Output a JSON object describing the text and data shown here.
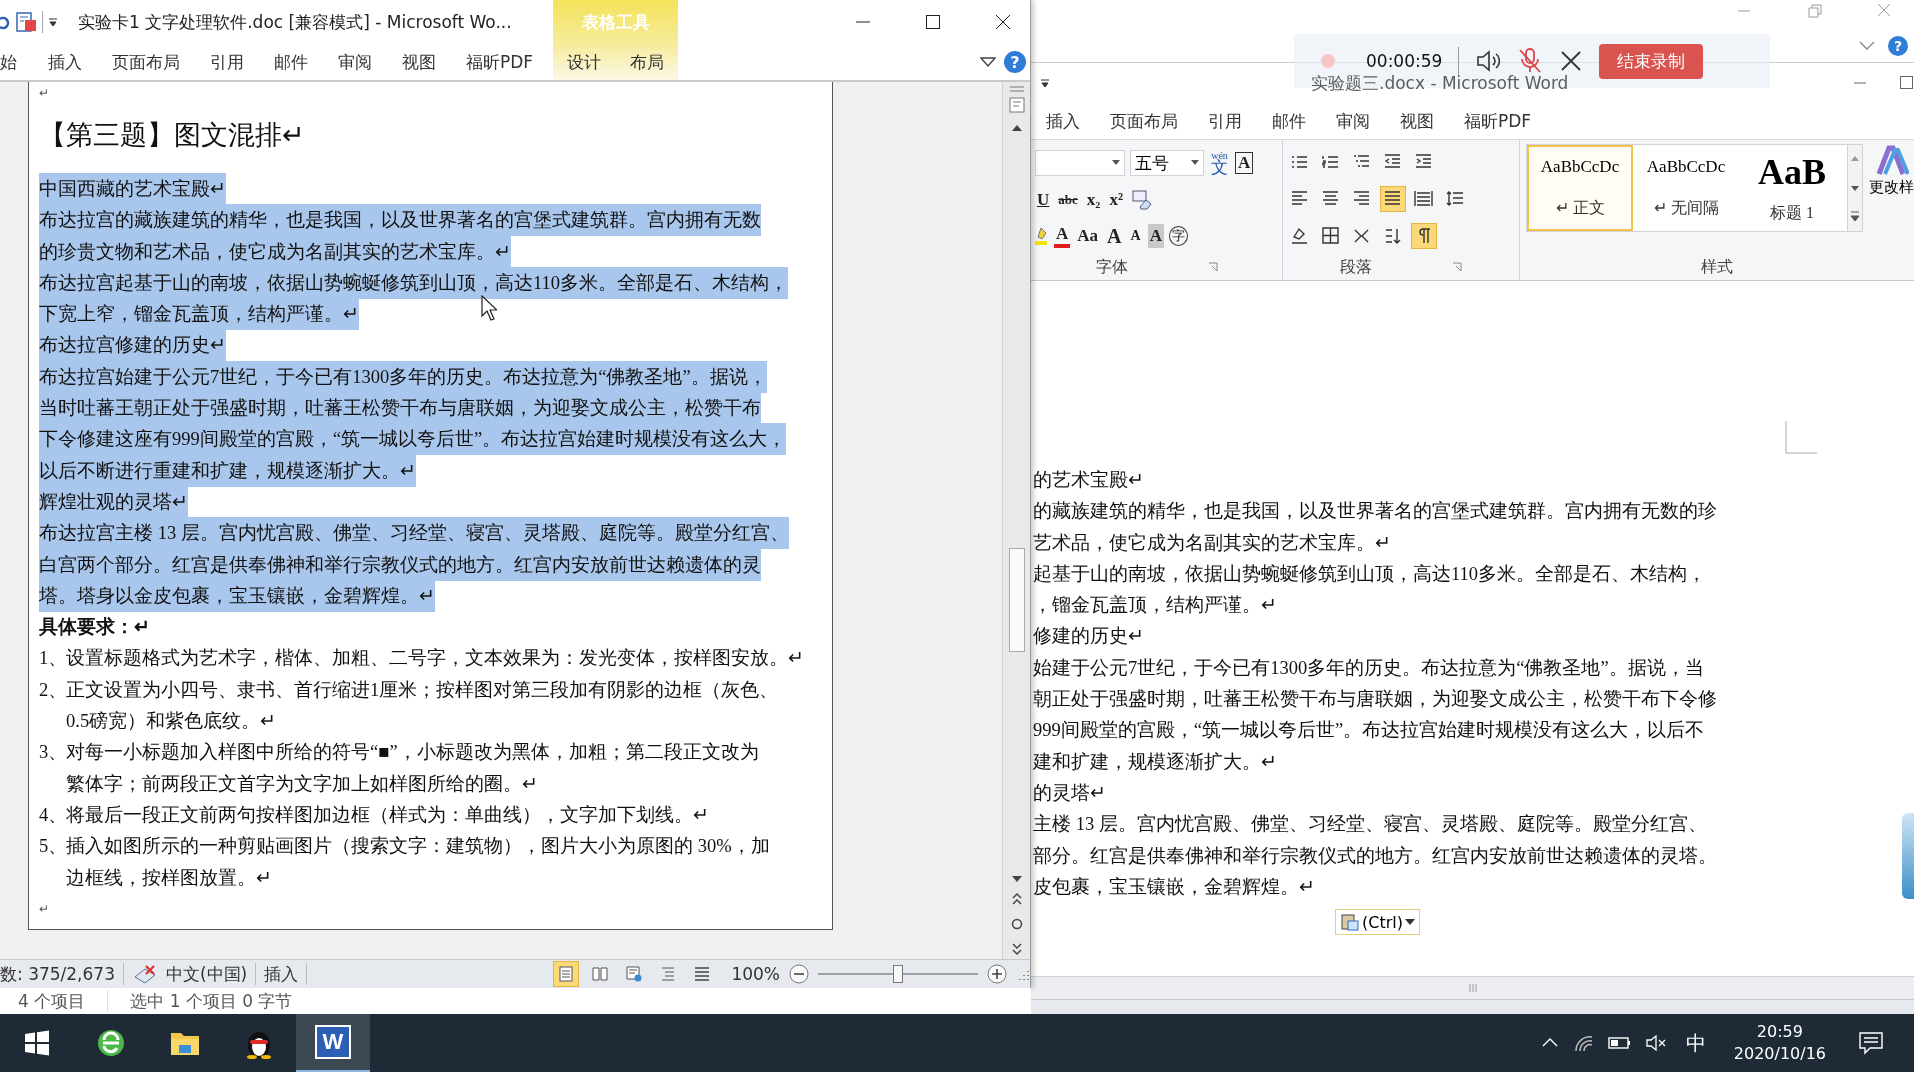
{
  "left_window": {
    "title": "实验卡1  文字处理软件.doc [兼容模式] - Microsoft Wo...",
    "contextual_group": "表格工具",
    "help": "?",
    "tabs": [
      {
        "label": "始",
        "contextual": false
      },
      {
        "label": "插入",
        "contextual": false
      },
      {
        "label": "页面布局",
        "contextual": false
      },
      {
        "label": "引用",
        "contextual": false
      },
      {
        "label": "邮件",
        "contextual": false
      },
      {
        "label": "审阅",
        "contextual": false
      },
      {
        "label": "视图",
        "contextual": false
      },
      {
        "label": "福昕PDF",
        "contextual": false
      },
      {
        "label": "设计",
        "contextual": true
      },
      {
        "label": "布局",
        "contextual": true
      }
    ],
    "document": {
      "top_mark": "↵",
      "heading": "【第三题】图文混排↵",
      "paragraphs": [
        {
          "selected": true,
          "lines": [
            "中国西藏的艺术宝殿↵"
          ]
        },
        {
          "selected": true,
          "lines": [
            "布达拉宫的藏族建筑的精华，也是我国，以及世界著名的宫堡式建筑群。宫内拥有无数",
            "的珍贵文物和艺术品，使它成为名副其实的艺术宝库。↵"
          ]
        },
        {
          "selected": true,
          "lines": [
            "布达拉宫起基于山的南坡，依据山势蜿蜒修筑到山顶，高达110多米。全部是石、木结构，",
            "下宽上窄，镏金瓦盖顶，结构严谨。↵"
          ]
        },
        {
          "selected": true,
          "lines": [
            "布达拉宫修建的历史↵"
          ]
        },
        {
          "selected": true,
          "lines": [
            "布达拉宫始建于公元7世纪，于今已有1300多年的历史。布达拉意为“佛教圣地”。据说，",
            "当时吐蕃王朝正处于强盛时期，吐蕃王松赞干布与唐联姻，为迎娶文成公主，松赞干布",
            "下令修建这座有999间殿堂的宫殿，“筑一城以夸后世”。布达拉宫始建时规模没有这么大，",
            "以后不断进行重建和扩建，规模逐渐扩大。↵"
          ]
        },
        {
          "selected": true,
          "lines": [
            "辉煌壮观的灵塔↵"
          ]
        },
        {
          "selected": true,
          "lines": [
            "布达拉宫主楼 13 层。宫内忧宫殿、佛堂、习经堂、寝宫、灵塔殿、庭院等。殿堂分红宫、",
            "白宫两个部分。红宫是供奉佛神和举行宗教仪式的地方。红宫内安放前世达赖遗体的灵",
            "塔。塔身以金皮包裹，宝玉镶嵌，金碧辉煌。↵"
          ]
        }
      ],
      "requirements_title": "具体要求：↵",
      "requirements": [
        {
          "number": "1、",
          "lines": [
            "设置标题格式为艺术字，楷体、加粗、二号字，文本效果为：发光变体，按样图安放。↵"
          ]
        },
        {
          "number": "2、",
          "lines": [
            "正文设置为小四号、隶书、首行缩进1厘米；按样图对第三段加有阴影的边框（灰色、",
            "0.5磅宽）和紫色底纹。↵"
          ]
        },
        {
          "number": "3、",
          "lines": [
            "对每一小标题加入样图中所给的符号“■”，小标题改为黑体，加粗；第二段正文改为",
            "繁体字；前两段正文首字为文字加上如样图所给的圈。↵"
          ]
        },
        {
          "number": "4、",
          "lines": [
            "将最后一段正文前两句按样图加边框（样式为：单曲线），文字加下划线。↵"
          ]
        },
        {
          "number": "5、",
          "lines": [
            "插入如图所示的一种剪贴画图片（搜索文字：建筑物），图片大小为原图的 30%，加",
            "边框线，按样图放置。↵"
          ]
        }
      ],
      "end_mark": "↵"
    },
    "status_bar": {
      "word_count": "数: 375/2,673",
      "language": "中文(中国)",
      "mode": "插入",
      "views": [
        {
          "selected": true
        },
        {
          "selected": false
        },
        {
          "selected": false
        },
        {
          "selected": false
        },
        {
          "selected": false
        }
      ],
      "zoom": "100%",
      "zoom_slider": {
        "level": 0.5
      }
    }
  },
  "explorer_status": {
    "item_count": "4 个项目",
    "selection": "选中 1 个项目  0 字节"
  },
  "recorder": {
    "elapsed": "00:00:59",
    "mic_muted": true,
    "stop_button": "结束录制"
  },
  "right_window": {
    "outer_help": "?",
    "title": "实验题三.docx - Microsoft Word",
    "tabs": [
      {
        "label": "插入"
      },
      {
        "label": "页面布局"
      },
      {
        "label": "引用"
      },
      {
        "label": "邮件"
      },
      {
        "label": "审阅"
      },
      {
        "label": "视图"
      },
      {
        "label": "福昕PDF"
      }
    ],
    "font_group": {
      "label": "字体",
      "font_size": "五号",
      "row1": [
        {
          "label": "文",
          "ruby": "wén",
          "kind": "phonetic"
        },
        {
          "label": "A",
          "kind": "border"
        }
      ],
      "row2": [
        {
          "label": "U",
          "kind": "underline"
        },
        {
          "label": "abc",
          "kind": "strike"
        },
        {
          "label": "x₂",
          "kind": "plain"
        },
        {
          "label": "x²",
          "kind": "plain"
        },
        {
          "kind": "clear"
        }
      ],
      "row3": [
        {
          "kind": "highlight"
        },
        {
          "label": "A",
          "kind": "color"
        },
        {
          "label": "Aa",
          "kind": "plain"
        },
        {
          "label": "A",
          "kind": "grow"
        },
        {
          "label": "A",
          "kind": "shrink"
        },
        {
          "label": "A",
          "kind": "shade"
        },
        {
          "label": "字",
          "kind": "enclose"
        }
      ]
    },
    "paragraph_group": {
      "label": "段落",
      "rows": [
        [
          {
            "kind": "bullets",
            "selected": false
          },
          {
            "kind": "numbering",
            "selected": false
          },
          {
            "kind": "multilevel",
            "selected": false
          },
          {
            "kind": "outdent",
            "selected": false
          },
          {
            "kind": "indent",
            "selected": false
          }
        ],
        [
          {
            "kind": "align-left",
            "selected": false
          },
          {
            "kind": "center",
            "selected": false
          },
          {
            "kind": "align-right",
            "selected": false
          },
          {
            "kind": "justify",
            "selected": true
          },
          {
            "kind": "distribute",
            "selected": false
          },
          {
            "kind": "line-spacing",
            "selected": false
          }
        ],
        [
          {
            "kind": "shading",
            "selected": false
          },
          {
            "kind": "borders",
            "selected": false
          },
          {
            "kind": "text-direction",
            "selected": false
          },
          {
            "kind": "sort",
            "selected": false
          },
          {
            "kind": "show-marks",
            "selected": true
          }
        ]
      ]
    },
    "styles_group": {
      "label": "样式",
      "styles": [
        {
          "preview": "AaBbCcDc",
          "name": "↵ 正文",
          "kind": "normal",
          "selected": true
        },
        {
          "preview": "AaBbCcDc",
          "name": "↵ 无间隔",
          "kind": "normal",
          "selected": false
        },
        {
          "preview": "AaB",
          "name": "标题 1",
          "kind": "heading",
          "selected": false
        }
      ],
      "change_styles": "更改样"
    },
    "document": {
      "lines": [
        "的艺术宝殿↵",
        "的藏族建筑的精华，也是我国，以及世界著名的宫堡式建筑群。宫内拥有无数的珍",
        "艺术品，使它成为名副其实的艺术宝库。↵",
        "起基于山的南坡，依据山势蜿蜒修筑到山顶，高达110多米。全部是石、木结构，",
        "，镏金瓦盖顶，结构严谨。↵",
        "修建的历史↵",
        "始建于公元7世纪，于今已有1300多年的历史。布达拉意为“佛教圣地”。据说，当",
        "朝正处于强盛时期，吐蕃王松赞干布与唐联姻，为迎娶文成公主，松赞干布下令修",
        "999间殿堂的宫殿，“筑一城以夸后世”。布达拉宫始建时规模没有这么大，以后不",
        "建和扩建，规模逐渐扩大。↵",
        "的灵塔↵",
        "主楼 13 层。宫内忧宫殿、佛堂、习经堂、寝宫、灵塔殿、庭院等。殿堂分红宫、",
        "部分。红宫是供奉佛神和举行宗教仪式的地方。红宫内安放前世达赖遗体的灵塔。",
        "皮包裹，宝玉镶嵌，金碧辉煌。↵"
      ],
      "paste_options": "(Ctrl)"
    }
  },
  "taskbar": {
    "apps": [
      {
        "kind": "start",
        "active": false
      },
      {
        "kind": "browser",
        "active": false
      },
      {
        "kind": "folder",
        "active": false
      },
      {
        "kind": "penguin",
        "active": false
      },
      {
        "kind": "word",
        "label": "W",
        "active": true
      }
    ],
    "ime": "中",
    "time": "20:59",
    "date": "2020/10/16"
  }
}
